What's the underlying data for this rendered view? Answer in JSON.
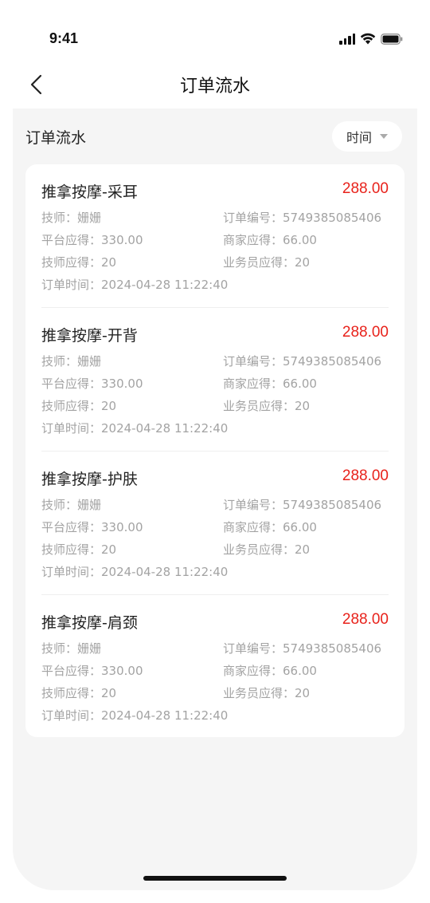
{
  "status_bar": {
    "time": "9:41"
  },
  "nav": {
    "title": "订单流水"
  },
  "section": {
    "title": "订单流水",
    "filter_label": "时间"
  },
  "orders": [
    {
      "name": "推拿按摩-采耳",
      "amount": "288.00",
      "technician": "技师：姗姗",
      "order_no": "订单编号：5749385085406",
      "platform_due": "平台应得：330.00",
      "merchant_due": "商家应得：66.00",
      "technician_due": "技师应得：20",
      "salesman_due": "业务员应得：20",
      "order_time": "订单时间：2024-04-28 11:22:40"
    },
    {
      "name": "推拿按摩-开背",
      "amount": "288.00",
      "technician": "技师：姗姗",
      "order_no": "订单编号：5749385085406",
      "platform_due": "平台应得：330.00",
      "merchant_due": "商家应得：66.00",
      "technician_due": "技师应得：20",
      "salesman_due": "业务员应得：20",
      "order_time": "订单时间：2024-04-28 11:22:40"
    },
    {
      "name": "推拿按摩-护肤",
      "amount": "288.00",
      "technician": "技师：姗姗",
      "order_no": "订单编号：5749385085406",
      "platform_due": "平台应得：330.00",
      "merchant_due": "商家应得：66.00",
      "technician_due": "技师应得：20",
      "salesman_due": "业务员应得：20",
      "order_time": "订单时间：2024-04-28 11:22:40"
    },
    {
      "name": "推拿按摩-肩颈",
      "amount": "288.00",
      "technician": "技师：姗姗",
      "order_no": "订单编号：5749385085406",
      "platform_due": "平台应得：330.00",
      "merchant_due": "商家应得：66.00",
      "technician_due": "技师应得：20",
      "salesman_due": "业务员应得：20",
      "order_time": "订单时间：2024-04-28 11:22:40"
    }
  ],
  "colors": {
    "accent_amount": "#e8221b",
    "page_background": "#f5f5f5",
    "card_background": "#ffffff",
    "secondary_text": "#a3a3a3"
  },
  "icons": {
    "back": "back-arrow-icon",
    "filter_caret": "caret-down-icon",
    "signal": "signal-icon",
    "wifi": "wifi-icon",
    "battery": "battery-icon"
  }
}
